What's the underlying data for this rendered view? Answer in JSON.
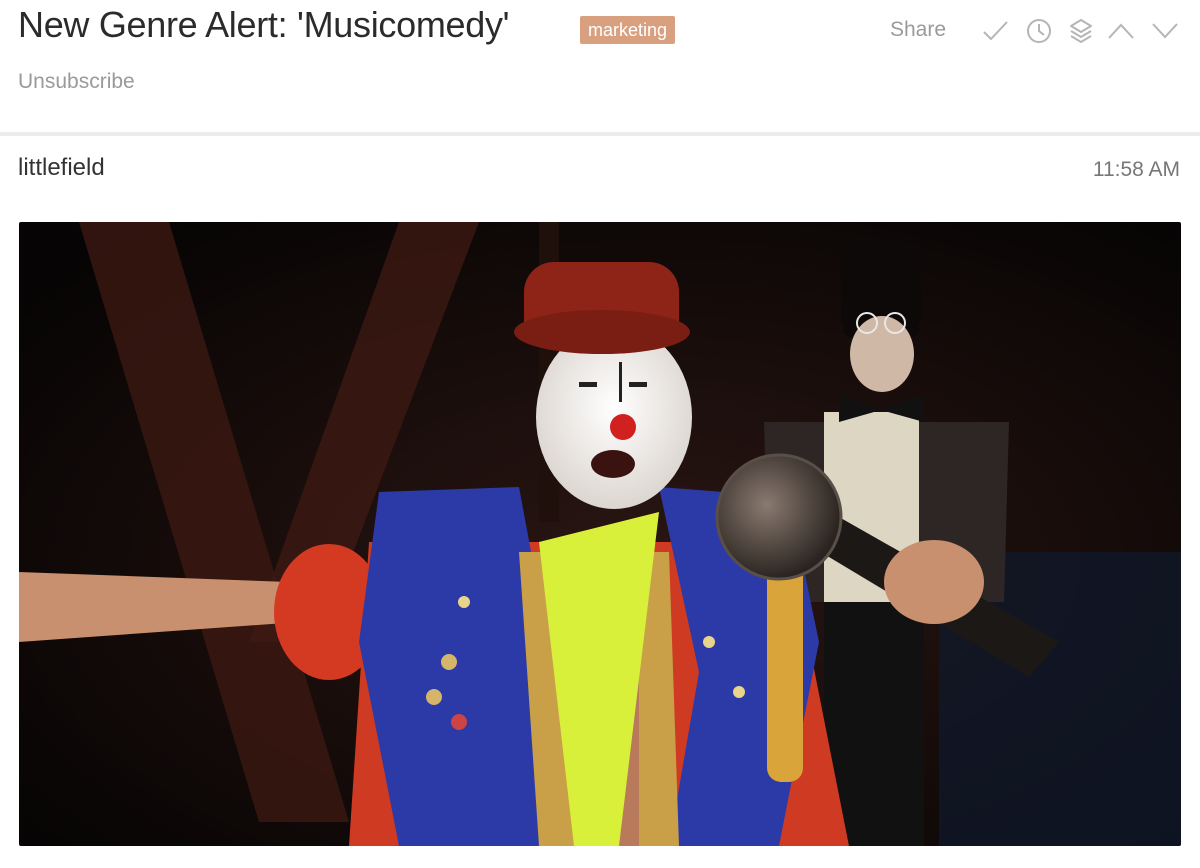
{
  "email": {
    "subject": "New Genre Alert: 'Musicomedy'",
    "label": "marketing",
    "unsubscribe_label": "Unsubscribe",
    "share_label": "Share",
    "sender": "littlefield",
    "time": "11:58 AM"
  },
  "toolbar": {
    "icons": [
      "checkmark-icon",
      "clock-icon",
      "layers-icon",
      "chevron-up-icon",
      "chevron-down-icon"
    ]
  },
  "colors": {
    "label_bg": "#d9a080",
    "muted_text": "#9a9a9a",
    "icon_stroke": "#b5b5b5"
  },
  "body": {
    "image": "photo of a clown singing into a microphone on stage, with a ringmaster in top hat in the background"
  }
}
